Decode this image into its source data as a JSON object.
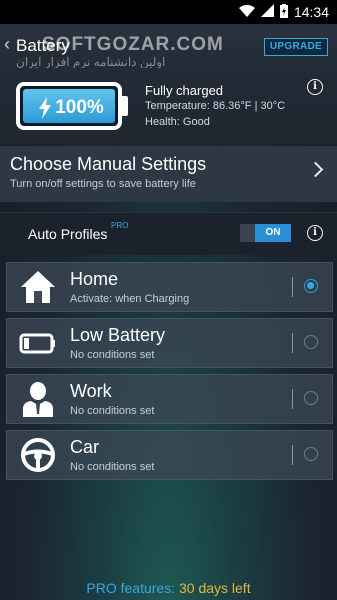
{
  "status_bar": {
    "time": "14:34"
  },
  "header": {
    "title": "Battery",
    "upgrade_label": "UPGRADE",
    "watermark_line1": "SOFTGOZAR.COM",
    "watermark_line2": "اولین دانشنامه نرم افزار ایران"
  },
  "battery": {
    "percent": "100%",
    "charge_status": "Fully charged",
    "temperature": "Temperature: 86.36°F | 30°C",
    "health": "Health: Good"
  },
  "manual_settings": {
    "title": "Choose Manual Settings",
    "subtitle": "Turn on/off settings to save battery life"
  },
  "auto_profiles": {
    "label": "Auto Profiles",
    "pro_badge": "PRO",
    "toggle_label": "ON"
  },
  "profiles": [
    {
      "name": "Home",
      "condition": "Activate: when Charging",
      "icon": "home-icon",
      "selected": true
    },
    {
      "name": "Low Battery",
      "condition": "No conditions set",
      "icon": "battery-low-icon",
      "selected": false
    },
    {
      "name": "Work",
      "condition": "No conditions set",
      "icon": "person-suit-icon",
      "selected": false
    },
    {
      "name": "Car",
      "condition": "No conditions set",
      "icon": "steering-wheel-icon",
      "selected": false
    }
  ],
  "footer": {
    "pro_label": "PRO features:",
    "days_left": "30 days left"
  },
  "colors": {
    "accent": "#36a9e1",
    "highlight": "#e9b43a"
  }
}
